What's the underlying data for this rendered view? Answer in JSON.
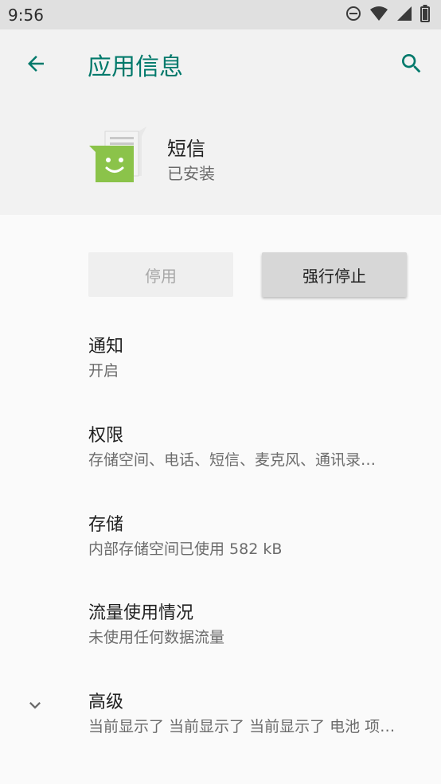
{
  "status_bar": {
    "time": "9:56",
    "icons": [
      "dnd-icon",
      "wifi-icon",
      "signal-icon",
      "battery-icon"
    ]
  },
  "app_bar": {
    "title": "应用信息",
    "back_icon": "arrow-back-icon",
    "search_icon": "search-icon",
    "accent_color": "#00796b"
  },
  "app": {
    "name": "短信",
    "status": "已安装",
    "icon": "messaging-app-icon"
  },
  "buttons": {
    "disable_label": "停用",
    "force_stop_label": "强行停止"
  },
  "prefs": [
    {
      "title": "通知",
      "summary": "开启"
    },
    {
      "title": "权限",
      "summary": "存储空间、电话、短信、麦克风、通讯录…"
    },
    {
      "title": "存储",
      "summary": "内部存储空间已使用 582 kB"
    },
    {
      "title": "流量使用情况",
      "summary": "未使用任何数据流量"
    },
    {
      "title": "高级",
      "summary": "当前显示了 当前显示了 当前显示了 电池 项…"
    }
  ],
  "advanced_icon": "chevron-down-icon"
}
